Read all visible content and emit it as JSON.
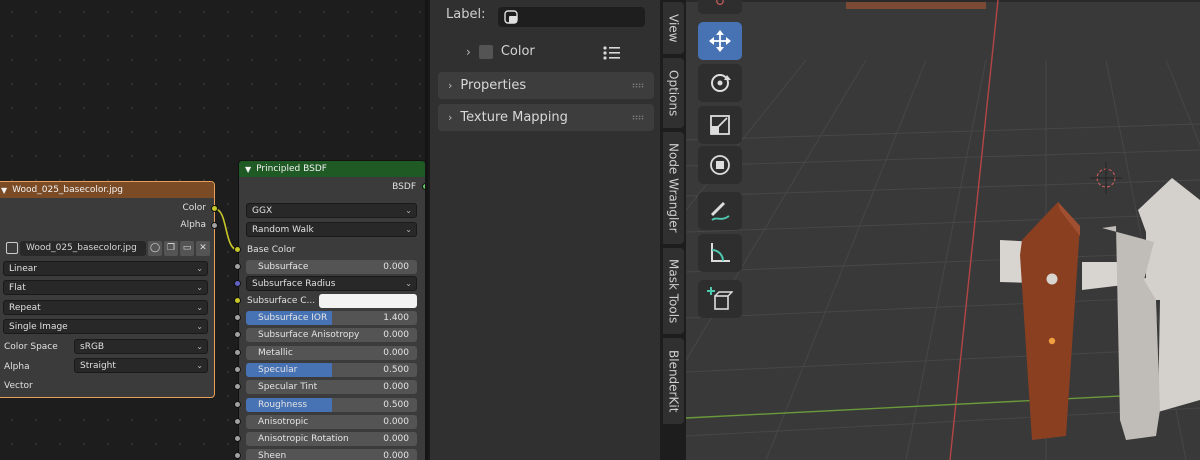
{
  "image_node": {
    "title": "Wood_025_basecolor.jpg",
    "outputs": [
      "Color",
      "Alpha"
    ],
    "image_name": "Wood_025_basecolor.jpg",
    "interpolation": "Linear",
    "projection": "Flat",
    "extension": "Repeat",
    "source": "Single Image",
    "color_space_label": "Color Space",
    "color_space": "sRGB",
    "alpha_label": "Alpha",
    "alpha": "Straight",
    "vector_label": "Vector"
  },
  "bsdf_node": {
    "title": "Principled BSDF",
    "output": "BSDF",
    "distribution": "GGX",
    "subsurface_method": "Random Walk",
    "base_color_label": "Base Color",
    "subsurface_radius": "Subsurface Radius",
    "subsurface_color_label": "Subsurface C...",
    "subsurface_color": "#f2f2f2",
    "fields": [
      {
        "label": "Subsurface",
        "value": "0.000",
        "fill": 0
      },
      {
        "label": "Subsurface IOR",
        "value": "1.400",
        "fill": 0.5
      },
      {
        "label": "Subsurface Anisotropy",
        "value": "0.000",
        "fill": 0
      },
      {
        "label": "Metallic",
        "value": "0.000",
        "fill": 0
      },
      {
        "label": "Specular",
        "value": "0.500",
        "fill": 0.5
      },
      {
        "label": "Specular Tint",
        "value": "0.000",
        "fill": 0
      },
      {
        "label": "Roughness",
        "value": "0.500",
        "fill": 0.5
      },
      {
        "label": "Anisotropic",
        "value": "0.000",
        "fill": 0
      },
      {
        "label": "Anisotropic Rotation",
        "value": "0.000",
        "fill": 0
      },
      {
        "label": "Sheen",
        "value": "0.000",
        "fill": 0
      }
    ]
  },
  "sidebar": {
    "label_caption": "Label:",
    "color_label": "Color",
    "panels": [
      "Properties",
      "Texture Mapping"
    ]
  },
  "tabs": [
    "View",
    "Options",
    "Node Wrangler",
    "Mask Tools",
    "BlenderKit"
  ],
  "colors": {
    "accent": "#4772b3",
    "wood": "#8b3f21",
    "image_header": "#7a4b25",
    "bsdf_header": "#1f5a25"
  }
}
